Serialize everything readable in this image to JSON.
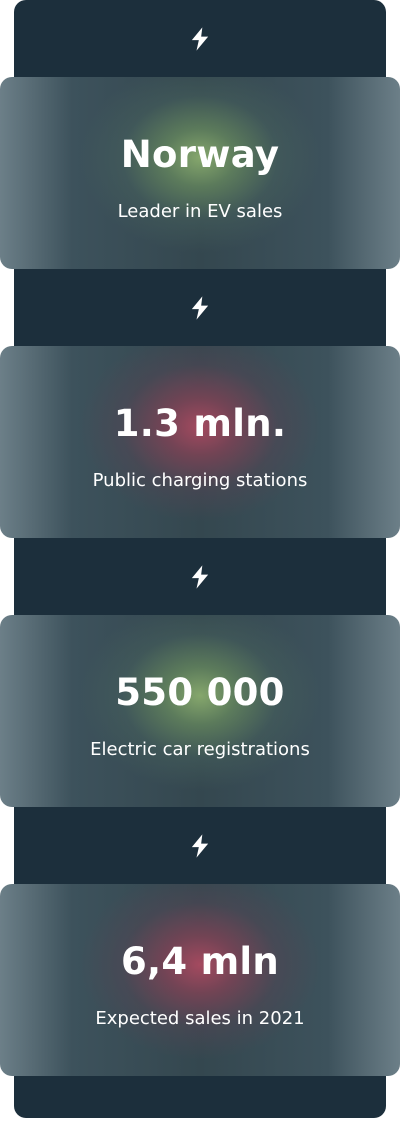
{
  "icon": "lightning-bolt-icon",
  "colors": {
    "background": "#1c2f3c",
    "card_green_glow": "#8aac6e",
    "card_red_glow": "#aa4a60",
    "text": "#ffffff"
  },
  "stats": [
    {
      "value": "Norway",
      "label": "Leader in EV sales",
      "accent": "green"
    },
    {
      "value": "1.3 mln.",
      "label": "Public charging stations",
      "accent": "red"
    },
    {
      "value": "550 000",
      "label": "Electric car registrations",
      "accent": "green"
    },
    {
      "value": "6,4 mln",
      "label": "Expected sales in 2021",
      "accent": "red"
    }
  ]
}
